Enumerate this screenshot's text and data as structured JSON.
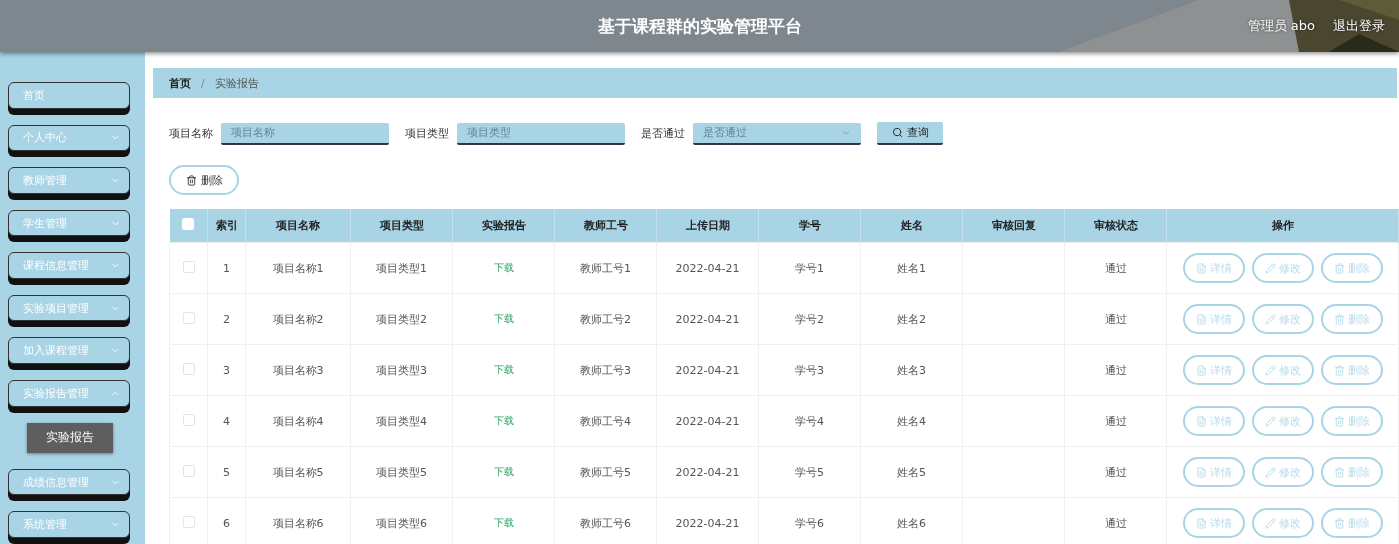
{
  "header": {
    "title": "基于课程群的实验管理平台",
    "user": "管理员 abo",
    "logout": "退出登录"
  },
  "sidebar": {
    "items": [
      {
        "label": "首页",
        "kind": "link"
      },
      {
        "label": "个人中心",
        "kind": "menu",
        "expanded": false
      },
      {
        "label": "教师管理",
        "kind": "menu",
        "expanded": false
      },
      {
        "label": "学生管理",
        "kind": "menu",
        "expanded": false
      },
      {
        "label": "课程信息管理",
        "kind": "menu",
        "expanded": false
      },
      {
        "label": "实验项目管理",
        "kind": "menu",
        "expanded": false
      },
      {
        "label": "加入课程管理",
        "kind": "menu",
        "expanded": false
      },
      {
        "label": "实验报告管理",
        "kind": "menu",
        "expanded": true,
        "children": [
          {
            "label": "实验报告"
          }
        ]
      },
      {
        "label": "成绩信息管理",
        "kind": "menu",
        "expanded": false
      },
      {
        "label": "系统管理",
        "kind": "menu",
        "expanded": false
      }
    ]
  },
  "breadcrumb": [
    "首页",
    "/",
    "实验报告"
  ],
  "search": {
    "fields": [
      {
        "label": "项目名称",
        "placeholder": "项目名称",
        "kind": "input"
      },
      {
        "label": "项目类型",
        "placeholder": "项目类型",
        "kind": "input"
      },
      {
        "label": "是否通过",
        "placeholder": "是否通过",
        "kind": "select"
      }
    ],
    "button": "查询"
  },
  "delete_button": "删除",
  "table": {
    "header_checked": false,
    "columns": [
      "索引",
      "项目名称",
      "项目类型",
      "实验报告",
      "教师工号",
      "上传日期",
      "学号",
      "姓名",
      "审核回复",
      "审核状态",
      "操作"
    ],
    "rows": [
      {
        "checked": false,
        "cells": [
          "1",
          "项目名称1",
          "项目类型1",
          "下载",
          "教师工号1",
          "2022-04-21",
          "学号1",
          "姓名1",
          "",
          "通过"
        ],
        "actions": [
          {
            "kind": "detail",
            "label": "详情"
          },
          {
            "kind": "edit",
            "label": "修改"
          },
          {
            "kind": "delete",
            "label": "删除"
          }
        ]
      },
      {
        "checked": false,
        "cells": [
          "2",
          "项目名称2",
          "项目类型2",
          "下载",
          "教师工号2",
          "2022-04-21",
          "学号2",
          "姓名2",
          "",
          "通过"
        ],
        "actions": [
          {
            "kind": "detail",
            "label": "详情"
          },
          {
            "kind": "edit",
            "label": "修改"
          },
          {
            "kind": "delete",
            "label": "删除"
          }
        ]
      },
      {
        "checked": false,
        "cells": [
          "3",
          "项目名称3",
          "项目类型3",
          "下载",
          "教师工号3",
          "2022-04-21",
          "学号3",
          "姓名3",
          "",
          "通过"
        ],
        "actions": [
          {
            "kind": "detail",
            "label": "详情"
          },
          {
            "kind": "edit",
            "label": "修改"
          },
          {
            "kind": "delete",
            "label": "删除"
          }
        ]
      },
      {
        "checked": false,
        "cells": [
          "4",
          "项目名称4",
          "项目类型4",
          "下载",
          "教师工号4",
          "2022-04-21",
          "学号4",
          "姓名4",
          "",
          "通过"
        ],
        "actions": [
          {
            "kind": "detail",
            "label": "详情"
          },
          {
            "kind": "edit",
            "label": "修改"
          },
          {
            "kind": "delete",
            "label": "删除"
          }
        ]
      },
      {
        "checked": false,
        "cells": [
          "5",
          "项目名称5",
          "项目类型5",
          "下载",
          "教师工号5",
          "2022-04-21",
          "学号5",
          "姓名5",
          "",
          "通过"
        ],
        "actions": [
          {
            "kind": "detail",
            "label": "详情"
          },
          {
            "kind": "edit",
            "label": "修改"
          },
          {
            "kind": "delete",
            "label": "删除"
          }
        ]
      },
      {
        "checked": false,
        "cells": [
          "6",
          "项目名称6",
          "项目类型6",
          "下载",
          "教师工号6",
          "2022-04-21",
          "学号6",
          "姓名6",
          "",
          "通过"
        ],
        "actions": [
          {
            "kind": "detail",
            "label": "详情"
          },
          {
            "kind": "edit",
            "label": "修改"
          },
          {
            "kind": "delete",
            "label": "删除"
          }
        ]
      }
    ]
  }
}
